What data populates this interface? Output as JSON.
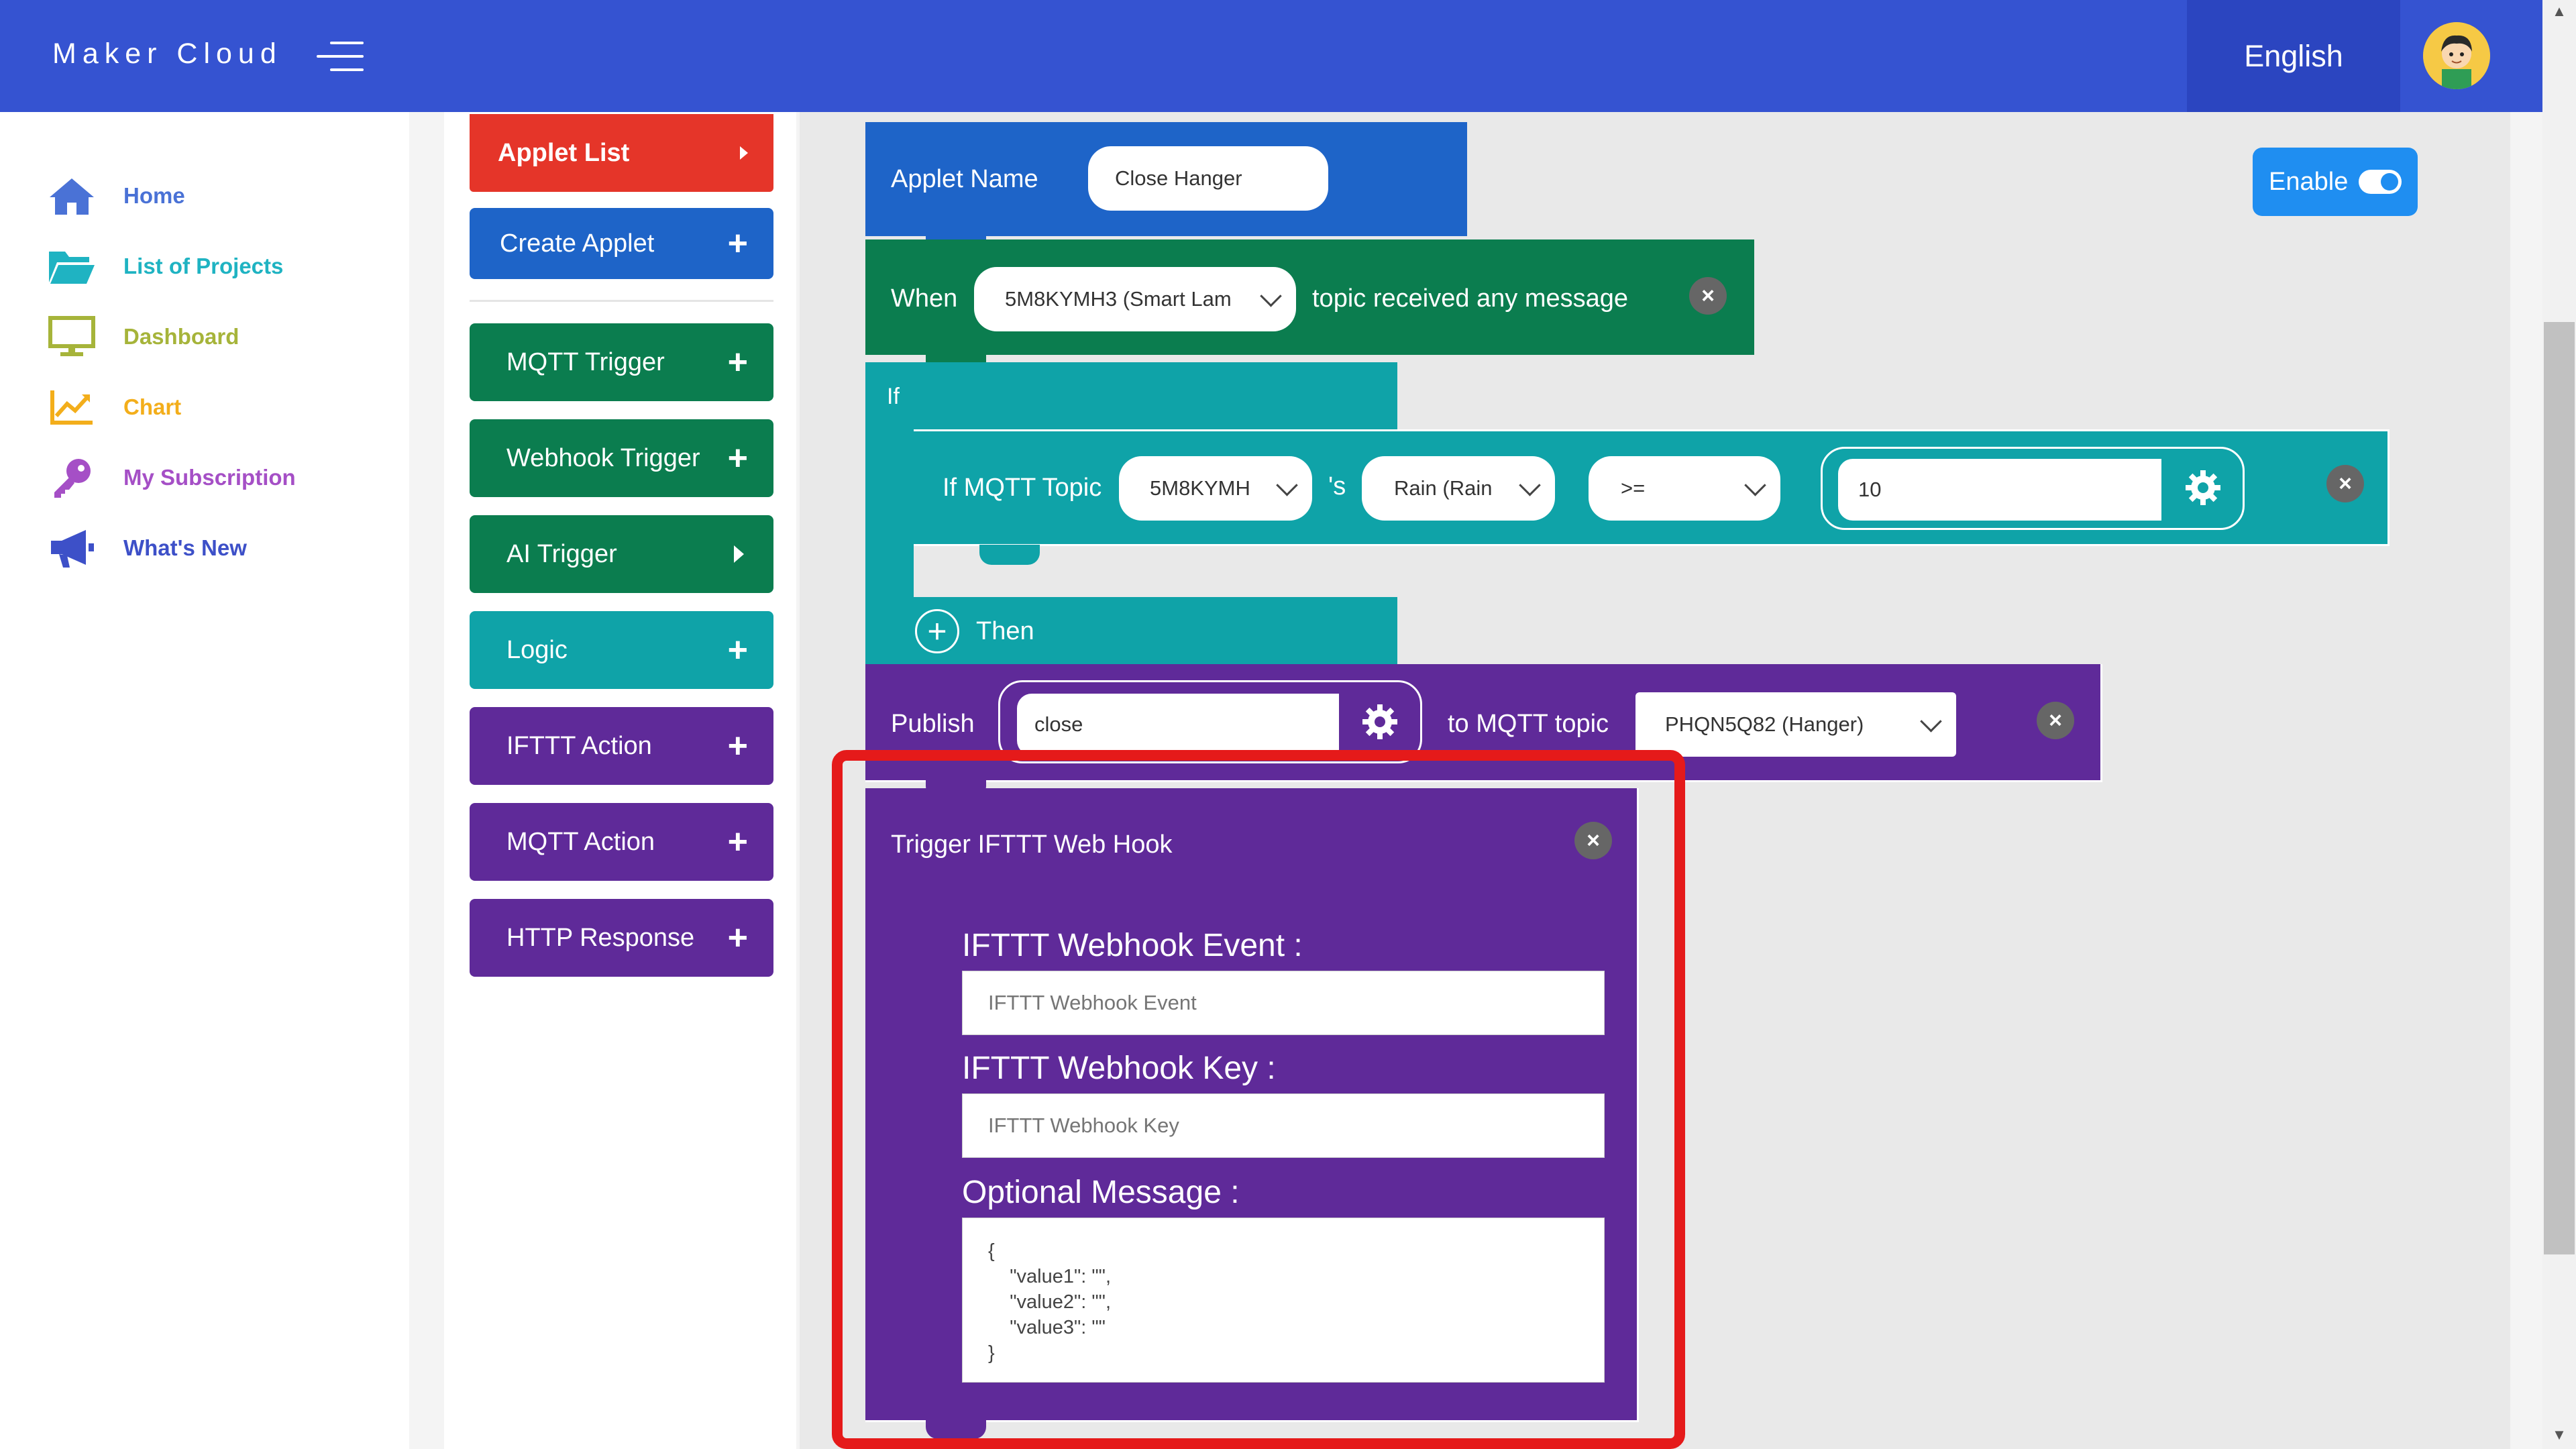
{
  "header": {
    "brand": "Maker Cloud",
    "language": "English"
  },
  "sidebar": {
    "items": [
      {
        "label": "Home",
        "icon": "home-icon",
        "color": "#4a72d6"
      },
      {
        "label": "List of Projects",
        "icon": "folder-icon",
        "color": "#1fb3c2"
      },
      {
        "label": "Dashboard",
        "icon": "monitor-icon",
        "color": "#a6b43a"
      },
      {
        "label": "Chart",
        "icon": "chart-icon",
        "color": "#f3ae1b"
      },
      {
        "label": "My Subscription",
        "icon": "key-icon",
        "color": "#a54fc6"
      },
      {
        "label": "What's New",
        "icon": "megaphone-icon",
        "color": "#3d50c8"
      }
    ]
  },
  "blocks": {
    "applet_list": "Applet List",
    "create_applet": "Create Applet",
    "mqtt_trigger": "MQTT Trigger",
    "webhook_trigger": "Webhook Trigger",
    "ai_trigger": "AI Trigger",
    "logic": "Logic",
    "ifttt_action": "IFTTT Action",
    "mqtt_action": "MQTT Action",
    "http_response": "HTTP Response"
  },
  "applet": {
    "name_label": "Applet Name",
    "name_value": "Close Hanger",
    "enable_label": "Enable",
    "when_label": "When",
    "when_device": "5M8KYMH3 (Smart Lam",
    "when_suffix": "topic received any message",
    "if_label": "If",
    "if_mqtt_label": "If MQTT Topic",
    "if_device": "5M8KYMH",
    "possessive": "'s",
    "if_field": "Rain (Rain",
    "if_operator": ">=",
    "if_value": "10",
    "then_label": "Then",
    "publish_label": "Publish",
    "publish_value": "close",
    "to_topic_label": "to MQTT topic",
    "publish_topic": "PHQN5Q82 (Hanger)"
  },
  "ifttt": {
    "title": "Trigger IFTTT Web Hook",
    "event_label": "IFTTT Webhook Event :",
    "event_placeholder": "IFTTT Webhook Event",
    "key_label": "IFTTT Webhook Key :",
    "key_placeholder": "IFTTT Webhook Key",
    "message_label": "Optional Message :",
    "message_value": "{\n    \"value1\": \"\",\n    \"value2\": \"\",\n    \"value3\": \"\"\n}"
  },
  "colors": {
    "header": "#3553d1",
    "applet_list": "#e53529",
    "create_applet": "#1e64c8",
    "trigger_green": "#0b7d4f",
    "logic_teal": "#0fa3a8",
    "action_purple": "#5f2a99",
    "highlight_red": "#e51a1a"
  }
}
